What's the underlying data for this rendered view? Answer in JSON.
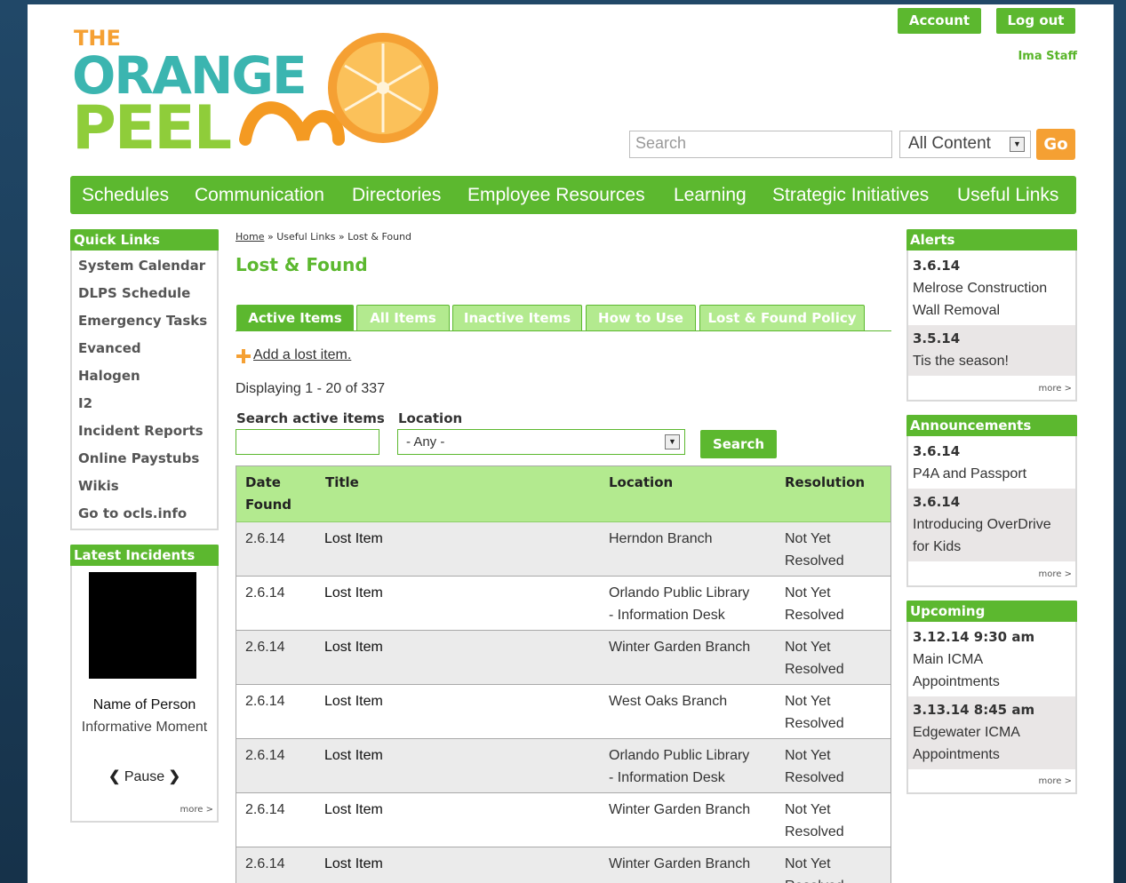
{
  "header": {
    "logo_the": "THE",
    "logo_orange": "ORANGE",
    "logo_peel": "PEEL",
    "account_label": "Account",
    "logout_label": "Log out",
    "user_name": "Ima Staff",
    "search_placeholder": "Search",
    "content_select_value": "All Content",
    "go_label": "Go"
  },
  "nav": {
    "items": [
      "Schedules",
      "Communication",
      "Directories",
      "Employee Resources",
      "Learning",
      "Strategic Initiatives",
      "Useful Links"
    ]
  },
  "quick_links": {
    "title": "Quick Links",
    "items": [
      "System Calendar",
      "DLPS Schedule",
      "Emergency Tasks",
      "Evanced",
      "Halogen",
      "I2",
      "Incident Reports",
      "Online Paystubs",
      "Wikis",
      "Go to ocls.info"
    ]
  },
  "latest_incidents": {
    "title": "Latest Incidents",
    "name": "Name of Person",
    "subtitle": "Informative Moment",
    "pause_label": "Pause",
    "more_label": "more >"
  },
  "breadcrumb": {
    "home": "Home",
    "sep1": " » ",
    "useful_links": "Useful Links",
    "sep2": " » ",
    "current": "Lost & Found"
  },
  "page_title": "Lost & Found",
  "tabs": [
    "Active Items",
    "All Items",
    "Inactive Items",
    "How to Use",
    "Lost & Found Policy"
  ],
  "add_link": "Add a lost item.",
  "displaying": "Displaying 1 - 20 of 337",
  "filters": {
    "search_label": "Search active items",
    "search_value": "",
    "location_label": "Location",
    "location_value": "- Any -",
    "search_button": "Search"
  },
  "table": {
    "headers": {
      "date_line1": "Date",
      "date_line2": "Found",
      "title": "Title",
      "location": "Location",
      "resolution": "Resolution"
    },
    "rows": [
      {
        "date": "2.6.14",
        "title": "Lost Item",
        "loc1": "Herndon Branch",
        "loc2": "",
        "res1": "Not Yet",
        "res2": "Resolved"
      },
      {
        "date": "2.6.14",
        "title": "Lost Item",
        "loc1": "Orlando Public Library",
        "loc2": "- Information Desk",
        "res1": "Not Yet",
        "res2": "Resolved"
      },
      {
        "date": "2.6.14",
        "title": "Lost Item",
        "loc1": "Winter Garden Branch",
        "loc2": "",
        "res1": "Not Yet",
        "res2": "Resolved"
      },
      {
        "date": "2.6.14",
        "title": "Lost Item",
        "loc1": "West Oaks Branch",
        "loc2": "",
        "res1": "Not Yet",
        "res2": "Resolved"
      },
      {
        "date": "2.6.14",
        "title": "Lost Item",
        "loc1": "Orlando Public Library",
        "loc2": "- Information Desk",
        "res1": "Not Yet",
        "res2": "Resolved"
      },
      {
        "date": "2.6.14",
        "title": "Lost Item",
        "loc1": "Winter Garden Branch",
        "loc2": "",
        "res1": "Not Yet",
        "res2": "Resolved"
      },
      {
        "date": "2.6.14",
        "title": "Lost Item",
        "loc1": "Winter Garden Branch",
        "loc2": "",
        "res1": "Not Yet",
        "res2": "Resolved"
      }
    ]
  },
  "alerts": {
    "title": "Alerts",
    "items": [
      {
        "date": "3.6.14",
        "line1": "Melrose Construction",
        "line2": "Wall Removal"
      },
      {
        "date": "3.5.14",
        "line1": "Tis the season!",
        "line2": ""
      }
    ],
    "more_label": "more >"
  },
  "announcements": {
    "title": "Announcements",
    "items": [
      {
        "date": "3.6.14",
        "line1": "P4A and Passport",
        "line2": ""
      },
      {
        "date": "3.6.14",
        "line1": "Introducing OverDrive",
        "line2": "for Kids"
      }
    ],
    "more_label": "more >"
  },
  "upcoming": {
    "title": "Upcoming",
    "items": [
      {
        "date": "3.12.14 9:30 am",
        "line1": "Main ICMA",
        "line2": "Appointments"
      },
      {
        "date": "3.13.14 8:45 am",
        "line1": "Edgewater ICMA",
        "line2": "Appointments"
      }
    ],
    "more_label": "more >"
  },
  "colors": {
    "brand_green": "#5cb82f",
    "light_green": "#b3ea8f",
    "orange": "#f5a033"
  }
}
